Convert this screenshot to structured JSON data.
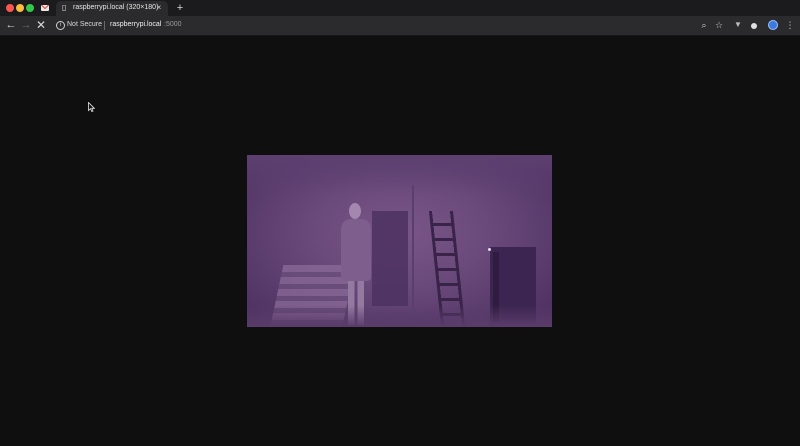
{
  "window": {
    "tabs": {
      "pinned": {
        "icon": "gmail-icon"
      },
      "active": {
        "title": "raspberrypi.local (320×180)",
        "favicon": "document-icon",
        "close_glyph": "×"
      },
      "new_tab_glyph": "+"
    }
  },
  "toolbar": {
    "back_glyph": "←",
    "forward_glyph": "→",
    "stop_glyph": "✕",
    "security_label": "Not Secure",
    "url_host": "raspberrypi.local",
    "url_port": ":5000",
    "zoom_glyph": "⌕",
    "star_glyph": "☆",
    "menu_glyph": "⋮"
  },
  "page": {
    "video_stream": {
      "description_icon": "camera-stream",
      "colors": {
        "tint": "#6a4a7b"
      }
    }
  },
  "colors": {
    "background": "#0f0f0f",
    "toolbar": "#2b2b2d",
    "tabstrip": "#1b1b1d"
  }
}
